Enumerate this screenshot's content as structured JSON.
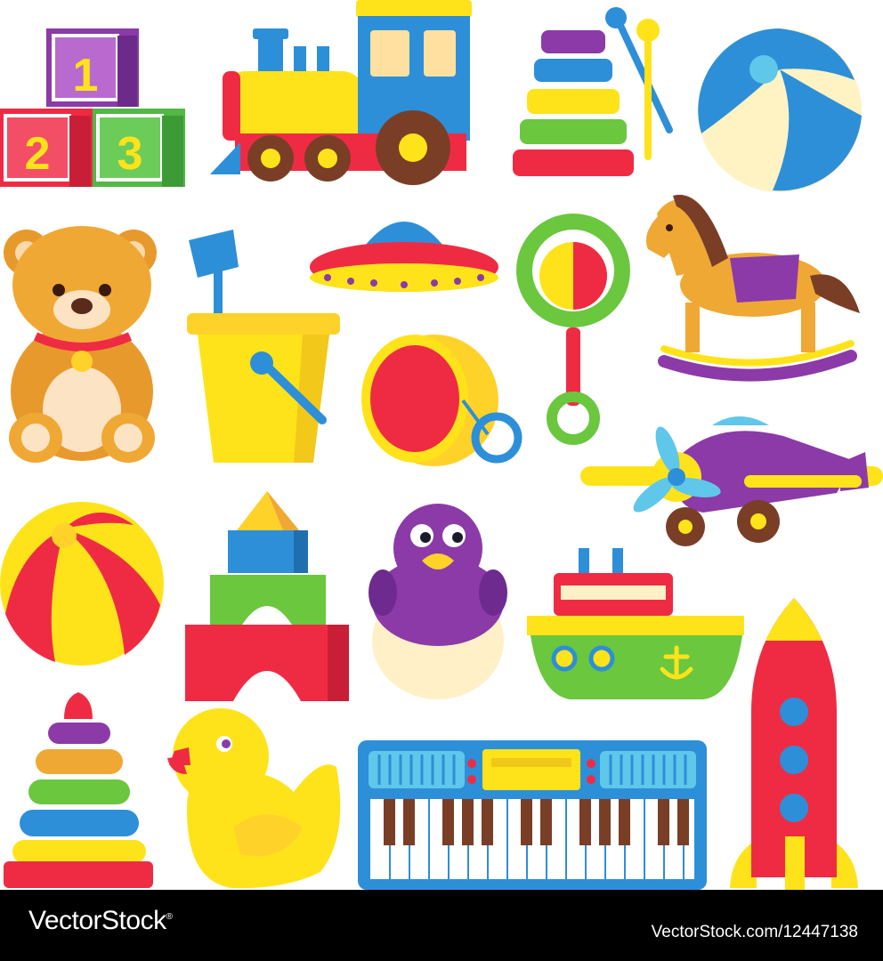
{
  "blocks": {
    "digits": [
      "1",
      "2",
      "3"
    ]
  },
  "footer": {
    "brand_label": "VectorStock",
    "registered_mark": "®",
    "credit_text": "VectorStock.com/12447138"
  },
  "colors": {
    "red": "#ef2b44",
    "yellow": "#ffe31a",
    "orange": "#fbb12a",
    "blue": "#2d8fd8",
    "light_blue": "#5fc7ea",
    "green": "#6ac73e",
    "purple": "#7f3aa8",
    "brown": "#7a3e27"
  },
  "items": [
    {
      "name": "number-blocks",
      "icon": "alphabet-blocks-icon"
    },
    {
      "name": "toy-train",
      "icon": "train-icon"
    },
    {
      "name": "xylophone",
      "icon": "xylophone-icon"
    },
    {
      "name": "beach-ball-blue",
      "icon": "ball-icon"
    },
    {
      "name": "teddy-bear",
      "icon": "teddy-bear-icon"
    },
    {
      "name": "sand-bucket",
      "icon": "bucket-icon"
    },
    {
      "name": "ufo",
      "icon": "ufo-icon"
    },
    {
      "name": "yo-yo",
      "icon": "yoyo-icon"
    },
    {
      "name": "rattle",
      "icon": "rattle-icon"
    },
    {
      "name": "rocking-horse",
      "icon": "rocking-horse-icon"
    },
    {
      "name": "airplane",
      "icon": "airplane-icon"
    },
    {
      "name": "beach-ball-red",
      "icon": "ball-icon"
    },
    {
      "name": "building-blocks",
      "icon": "blocks-icon"
    },
    {
      "name": "roly-poly-penguin",
      "icon": "penguin-icon"
    },
    {
      "name": "toy-boat",
      "icon": "boat-icon"
    },
    {
      "name": "rocket",
      "icon": "rocket-icon"
    },
    {
      "name": "stacking-pyramid",
      "icon": "pyramid-icon"
    },
    {
      "name": "rubber-duck",
      "icon": "duck-icon"
    },
    {
      "name": "piano-keyboard",
      "icon": "piano-icon"
    }
  ]
}
